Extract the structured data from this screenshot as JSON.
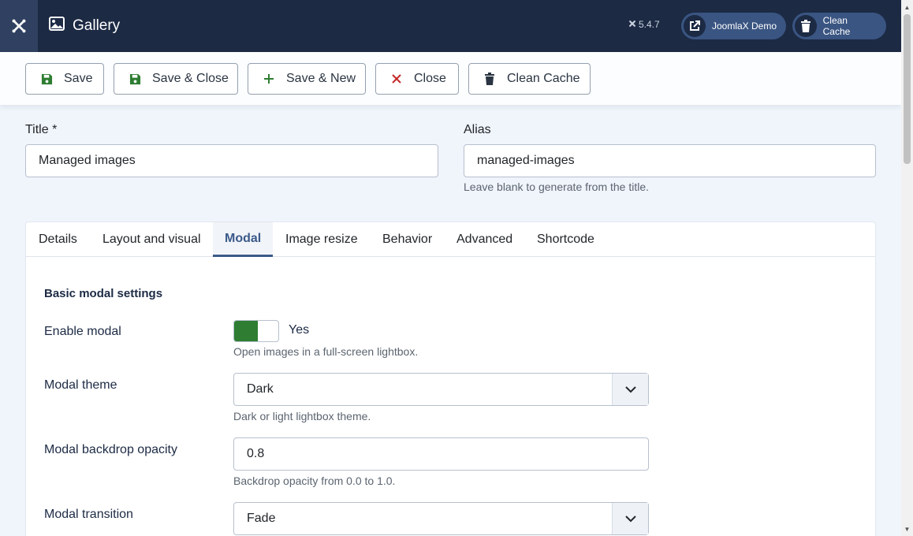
{
  "header": {
    "app_title": "Gallery",
    "version": "5.4.7",
    "demo_button": "JoomlaX Demo",
    "cache_button": "Clean Cache"
  },
  "toolbar": {
    "save": "Save",
    "save_close": "Save & Close",
    "save_new": "Save & New",
    "close": "Close",
    "clean_cache": "Clean Cache"
  },
  "form": {
    "title_label": "Title *",
    "title_value": "Managed images",
    "alias_label": "Alias",
    "alias_value": "managed-images",
    "alias_help": "Leave blank to generate from the title."
  },
  "tabs": [
    "Details",
    "Layout and visual",
    "Modal",
    "Image resize",
    "Behavior",
    "Advanced",
    "Shortcode"
  ],
  "active_tab": "Modal",
  "modal": {
    "section_title": "Basic modal settings",
    "enable_label": "Enable modal",
    "enable_value": "Yes",
    "enable_help": "Open images in a full-screen lightbox.",
    "theme_label": "Modal theme",
    "theme_value": "Dark",
    "theme_help": "Dark or light lightbox theme.",
    "opacity_label": "Modal backdrop opacity",
    "opacity_value": "0.8",
    "opacity_help": "Backdrop opacity from 0.0 to 1.0.",
    "transition_label": "Modal transition",
    "transition_value": "Fade"
  },
  "colors": {
    "header_bg": "#1c2a44",
    "accent": "#3b5a8a",
    "toggle_on": "#2e7d32",
    "close_icon": "#c62828",
    "save_icon": "#2e7d32"
  },
  "icons": {
    "logo": "joomla-logo-icon",
    "title": "image-icon",
    "external": "external-link-icon",
    "trash": "trash-icon",
    "save": "floppy-disk-icon",
    "add": "plus-icon",
    "close": "x-icon",
    "caret": "chevron-down-icon"
  }
}
